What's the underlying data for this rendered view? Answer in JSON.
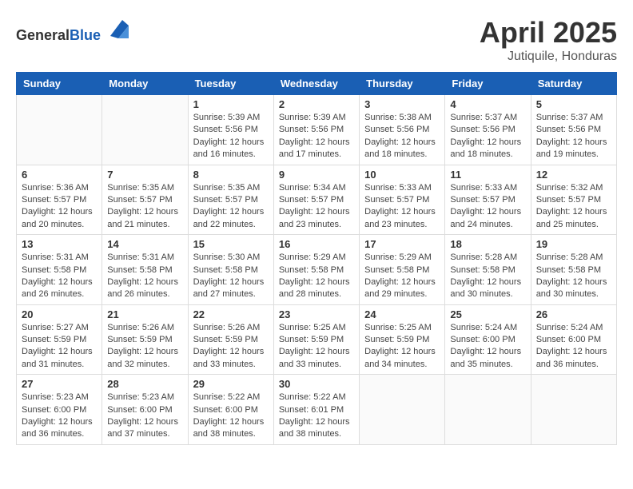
{
  "header": {
    "logo_general": "General",
    "logo_blue": "Blue",
    "month_year": "April 2025",
    "location": "Jutiquile, Honduras"
  },
  "weekdays": [
    "Sunday",
    "Monday",
    "Tuesday",
    "Wednesday",
    "Thursday",
    "Friday",
    "Saturday"
  ],
  "weeks": [
    [
      {
        "day": "",
        "info": ""
      },
      {
        "day": "",
        "info": ""
      },
      {
        "day": "1",
        "info": "Sunrise: 5:39 AM\nSunset: 5:56 PM\nDaylight: 12 hours\nand 16 minutes."
      },
      {
        "day": "2",
        "info": "Sunrise: 5:39 AM\nSunset: 5:56 PM\nDaylight: 12 hours\nand 17 minutes."
      },
      {
        "day": "3",
        "info": "Sunrise: 5:38 AM\nSunset: 5:56 PM\nDaylight: 12 hours\nand 18 minutes."
      },
      {
        "day": "4",
        "info": "Sunrise: 5:37 AM\nSunset: 5:56 PM\nDaylight: 12 hours\nand 18 minutes."
      },
      {
        "day": "5",
        "info": "Sunrise: 5:37 AM\nSunset: 5:56 PM\nDaylight: 12 hours\nand 19 minutes."
      }
    ],
    [
      {
        "day": "6",
        "info": "Sunrise: 5:36 AM\nSunset: 5:57 PM\nDaylight: 12 hours\nand 20 minutes."
      },
      {
        "day": "7",
        "info": "Sunrise: 5:35 AM\nSunset: 5:57 PM\nDaylight: 12 hours\nand 21 minutes."
      },
      {
        "day": "8",
        "info": "Sunrise: 5:35 AM\nSunset: 5:57 PM\nDaylight: 12 hours\nand 22 minutes."
      },
      {
        "day": "9",
        "info": "Sunrise: 5:34 AM\nSunset: 5:57 PM\nDaylight: 12 hours\nand 23 minutes."
      },
      {
        "day": "10",
        "info": "Sunrise: 5:33 AM\nSunset: 5:57 PM\nDaylight: 12 hours\nand 23 minutes."
      },
      {
        "day": "11",
        "info": "Sunrise: 5:33 AM\nSunset: 5:57 PM\nDaylight: 12 hours\nand 24 minutes."
      },
      {
        "day": "12",
        "info": "Sunrise: 5:32 AM\nSunset: 5:57 PM\nDaylight: 12 hours\nand 25 minutes."
      }
    ],
    [
      {
        "day": "13",
        "info": "Sunrise: 5:31 AM\nSunset: 5:58 PM\nDaylight: 12 hours\nand 26 minutes."
      },
      {
        "day": "14",
        "info": "Sunrise: 5:31 AM\nSunset: 5:58 PM\nDaylight: 12 hours\nand 26 minutes."
      },
      {
        "day": "15",
        "info": "Sunrise: 5:30 AM\nSunset: 5:58 PM\nDaylight: 12 hours\nand 27 minutes."
      },
      {
        "day": "16",
        "info": "Sunrise: 5:29 AM\nSunset: 5:58 PM\nDaylight: 12 hours\nand 28 minutes."
      },
      {
        "day": "17",
        "info": "Sunrise: 5:29 AM\nSunset: 5:58 PM\nDaylight: 12 hours\nand 29 minutes."
      },
      {
        "day": "18",
        "info": "Sunrise: 5:28 AM\nSunset: 5:58 PM\nDaylight: 12 hours\nand 30 minutes."
      },
      {
        "day": "19",
        "info": "Sunrise: 5:28 AM\nSunset: 5:58 PM\nDaylight: 12 hours\nand 30 minutes."
      }
    ],
    [
      {
        "day": "20",
        "info": "Sunrise: 5:27 AM\nSunset: 5:59 PM\nDaylight: 12 hours\nand 31 minutes."
      },
      {
        "day": "21",
        "info": "Sunrise: 5:26 AM\nSunset: 5:59 PM\nDaylight: 12 hours\nand 32 minutes."
      },
      {
        "day": "22",
        "info": "Sunrise: 5:26 AM\nSunset: 5:59 PM\nDaylight: 12 hours\nand 33 minutes."
      },
      {
        "day": "23",
        "info": "Sunrise: 5:25 AM\nSunset: 5:59 PM\nDaylight: 12 hours\nand 33 minutes."
      },
      {
        "day": "24",
        "info": "Sunrise: 5:25 AM\nSunset: 5:59 PM\nDaylight: 12 hours\nand 34 minutes."
      },
      {
        "day": "25",
        "info": "Sunrise: 5:24 AM\nSunset: 6:00 PM\nDaylight: 12 hours\nand 35 minutes."
      },
      {
        "day": "26",
        "info": "Sunrise: 5:24 AM\nSunset: 6:00 PM\nDaylight: 12 hours\nand 36 minutes."
      }
    ],
    [
      {
        "day": "27",
        "info": "Sunrise: 5:23 AM\nSunset: 6:00 PM\nDaylight: 12 hours\nand 36 minutes."
      },
      {
        "day": "28",
        "info": "Sunrise: 5:23 AM\nSunset: 6:00 PM\nDaylight: 12 hours\nand 37 minutes."
      },
      {
        "day": "29",
        "info": "Sunrise: 5:22 AM\nSunset: 6:00 PM\nDaylight: 12 hours\nand 38 minutes."
      },
      {
        "day": "30",
        "info": "Sunrise: 5:22 AM\nSunset: 6:01 PM\nDaylight: 12 hours\nand 38 minutes."
      },
      {
        "day": "",
        "info": ""
      },
      {
        "day": "",
        "info": ""
      },
      {
        "day": "",
        "info": ""
      }
    ]
  ]
}
